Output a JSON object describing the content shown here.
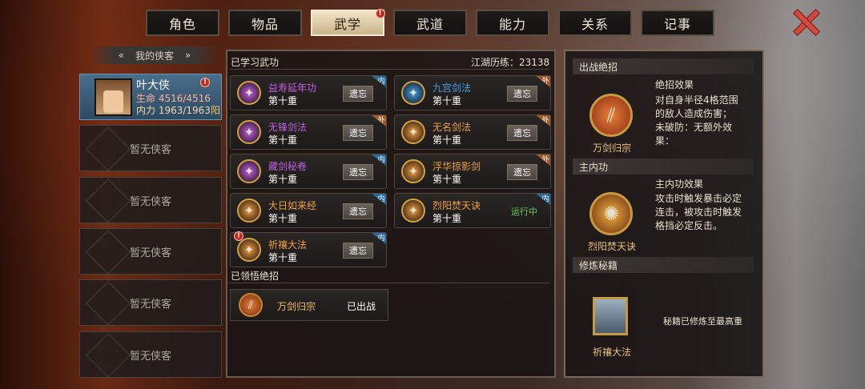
{
  "tabs": [
    {
      "label": "角色"
    },
    {
      "label": "物品"
    },
    {
      "label": "武学"
    },
    {
      "label": "武道"
    },
    {
      "label": "能力"
    },
    {
      "label": "关系"
    },
    {
      "label": "记事"
    }
  ],
  "tab_badge": "!",
  "sidebar": {
    "title": "我的侠客",
    "hero": {
      "name": "叶大侠",
      "hp": "生命 4516/4516",
      "mp": "内力 1963/1963",
      "yin_yang": "阳"
    },
    "empty_label": "暂无侠客"
  },
  "learned": {
    "title": "已学习武功",
    "exp": "江湖历练：23138"
  },
  "skills": [
    {
      "name": "益寿延年功",
      "level": "第十重",
      "action": "遗忘",
      "type": "内",
      "color": "#c060e0",
      "icon": "swirl-icon"
    },
    {
      "name": "九宫剑法",
      "level": "第十重",
      "action": "遗忘",
      "type": "外",
      "color": "#40a0e8",
      "icon": "sword-fan-icon"
    },
    {
      "name": "无锋剑法",
      "level": "第十重",
      "action": "遗忘",
      "type": "外",
      "color": "#c060e0",
      "icon": "blade-icon"
    },
    {
      "name": "无名剑法",
      "level": "第十重",
      "action": "遗忘",
      "type": "外",
      "color": "#f0a040",
      "icon": "slash-icon"
    },
    {
      "name": "藏剑秘卷",
      "level": "第十重",
      "action": "遗忘",
      "type": "内",
      "color": "#c060e0",
      "icon": "scroll-icon"
    },
    {
      "name": "浮华掠影剑",
      "level": "第十重",
      "action": "遗忘",
      "type": "外",
      "color": "#f0a040",
      "icon": "shadow-sword-icon"
    },
    {
      "name": "大日如来经",
      "level": "第十重",
      "action": "遗忘",
      "type": "内",
      "color": "#f0a040",
      "icon": "sun-icon"
    },
    {
      "name": "烈阳焚天诀",
      "level": "第十重",
      "action": "运行中",
      "type": "内",
      "color": "#f0a040",
      "icon": "flame-icon"
    },
    {
      "name": "祈禳大法",
      "level": "第十重",
      "action": "遗忘",
      "type": "内",
      "color": "#f0a040",
      "icon": "prayer-icon"
    }
  ],
  "comprehended": {
    "title": "已领悟绝招",
    "name": "万剑归宗",
    "status": "已出战"
  },
  "right": {
    "battle_title": "出战绝招",
    "ult_caption": "万剑归宗",
    "ult_effect_title": "绝招效果",
    "ult_effect_lines": [
      "对自身半径4格范围",
      "的敌人造成伤害；",
      "未破防：无额外效",
      "果："
    ],
    "main_title": "主内功",
    "main_caption": "烈阳焚天诀",
    "main_effect_title": "主内功效果",
    "main_effect_lines": [
      "攻击时触发暴击必定",
      "连击，被攻击时触发",
      "格挡必定反击。"
    ],
    "train_title": "修炼秘籍",
    "train_caption": "祈禳大法",
    "train_status": "秘籍已修炼至最高重"
  }
}
